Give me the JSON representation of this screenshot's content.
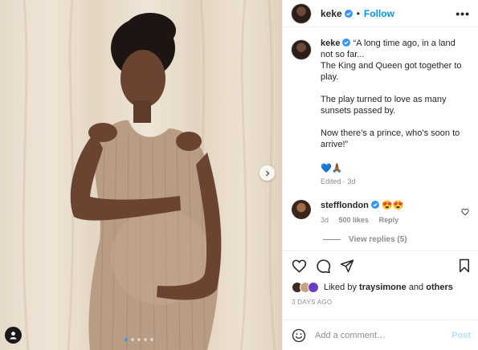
{
  "post": {
    "author": "keke",
    "follow_label": "Follow",
    "header_separator": "•",
    "more_label": "•••",
    "caption": "“A long time ago, in a land not so far...\nThe King and Queen got together to play.\n\nThe play turned to love as many sunsets passed by.\n\nNow there’s a prince, who’s soon to arrive!”",
    "caption_emoji": "💙🙏🏾",
    "edited_meta": "Edited · 3d",
    "carousel": {
      "count": 5,
      "active_index": 0
    }
  },
  "comments": [
    {
      "username": "stefflondon",
      "text": "😍😍",
      "age": "3d",
      "likes": "500 likes",
      "reply_label": "Reply",
      "view_replies": "View replies (5)"
    }
  ],
  "actions": {
    "icons": [
      "heart-icon",
      "comment-icon",
      "share-icon",
      "bookmark-icon"
    ]
  },
  "likes": {
    "prefix": "Liked by",
    "user": "traysimone",
    "connector": "and",
    "others": "others"
  },
  "timestamp": "3 DAYS AGO",
  "add_comment": {
    "placeholder": "Add a comment…",
    "post_label": "Post"
  },
  "colors": {
    "accent": "#0095f6",
    "post_disabled": "#b2dffc",
    "verified": "#3897f0",
    "text": "#262626",
    "muted": "#8e8e8e"
  }
}
